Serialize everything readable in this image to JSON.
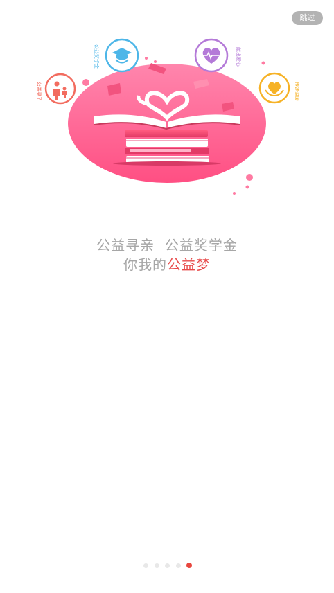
{
  "skip_label": "跳过",
  "tagline": {
    "line1": "公益寻亲  公益奖学金",
    "line2_prefix": "你我的",
    "line2_highlight": "公益梦"
  },
  "icons": [
    {
      "name": "parent-child-icon",
      "caption": "公益寻子"
    },
    {
      "name": "graduate-icon",
      "caption": "公益奖学金"
    },
    {
      "name": "heartbeat-icon",
      "caption": "献出爱心"
    },
    {
      "name": "love-hands-icon",
      "caption": "传递温暖"
    }
  ],
  "pagination": {
    "count": 5,
    "active_index": 4
  },
  "colors": {
    "accent": "#e8473f",
    "circle_pink": "#ff5e8f",
    "skip_bg": "#b3b3b3",
    "tagline_gray": "#a6a6a6"
  }
}
